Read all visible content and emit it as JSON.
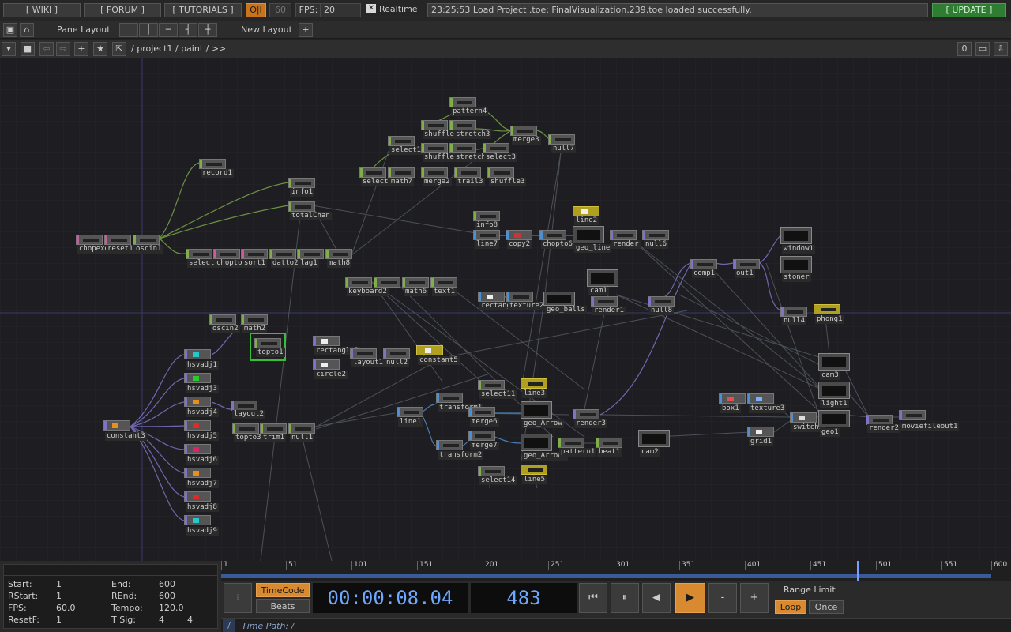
{
  "topbar": {
    "wiki": "[ WIKI ]",
    "forum": "[ FORUM ]",
    "tutorials": "[ TUTORIALS ]",
    "oi": "O|I",
    "fps_box": "60",
    "fps_label": "FPS:",
    "fps_value": "20",
    "realtime_check": "✕",
    "realtime_label": "Realtime",
    "status": "23:25:53 Load Project .toe: FinalVisualization.239.toe loaded successfully.",
    "update": "[ UPDATE ]"
  },
  "row2": {
    "pane_layout": "Pane Layout",
    "new_layout": "New Layout",
    "plus": "+"
  },
  "row3": {
    "path": "/ project1 / paint / >>",
    "counter": "0"
  },
  "nodes": [
    {
      "label": "record1"
    },
    {
      "label": "info1"
    },
    {
      "label": "totalChan"
    },
    {
      "label": "chopexec"
    },
    {
      "label": "reset1"
    },
    {
      "label": "oscin1"
    },
    {
      "label": "select5"
    },
    {
      "label": "chopto2"
    },
    {
      "label": "sort1"
    },
    {
      "label": "datto2"
    },
    {
      "label": "lag1"
    },
    {
      "label": "math8"
    },
    {
      "label": "pattern4"
    },
    {
      "label": "shuffle4"
    },
    {
      "label": "stretch3"
    },
    {
      "label": "merge3"
    },
    {
      "label": "select1"
    },
    {
      "label": "shuffle1"
    },
    {
      "label": "stretch4"
    },
    {
      "label": "select3"
    },
    {
      "label": "null7"
    },
    {
      "label": "select2"
    },
    {
      "label": "math7"
    },
    {
      "label": "merge2"
    },
    {
      "label": "trail3"
    },
    {
      "label": "shuffle3"
    },
    {
      "label": "info8"
    },
    {
      "label": "line7"
    },
    {
      "label": "chopto6"
    },
    {
      "label": "copy2"
    },
    {
      "label": "line2"
    },
    {
      "label": "geo_line"
    },
    {
      "label": "render"
    },
    {
      "label": "null6"
    },
    {
      "label": "window1"
    },
    {
      "label": "stoner"
    },
    {
      "label": "comp1"
    },
    {
      "label": "out1"
    },
    {
      "label": "null4"
    },
    {
      "label": "phong1"
    },
    {
      "label": "keyboard2"
    },
    {
      "label": "math6"
    },
    {
      "label": "text1"
    },
    {
      "label": "cam1"
    },
    {
      "label": "rectangle1"
    },
    {
      "label": "texture2"
    },
    {
      "label": "geo_balls"
    },
    {
      "label": "render1"
    },
    {
      "label": "null8"
    },
    {
      "label": "oscin2"
    },
    {
      "label": "math2"
    },
    {
      "label": "topto1"
    },
    {
      "label": "rectangle2"
    },
    {
      "label": "circle2"
    },
    {
      "label": "layout1"
    },
    {
      "label": "null2"
    },
    {
      "label": "constant5"
    },
    {
      "label": "hsvadj1"
    },
    {
      "label": "hsvadj3"
    },
    {
      "label": "hsvadj4"
    },
    {
      "label": "layout2"
    },
    {
      "label": "hsvadj5"
    },
    {
      "label": "hsvadj6"
    },
    {
      "label": "hsvadj7"
    },
    {
      "label": "hsvadj8"
    },
    {
      "label": "hsvadj9"
    },
    {
      "label": "constant3"
    },
    {
      "label": "topto3"
    },
    {
      "label": "trim1"
    },
    {
      "label": "null1"
    },
    {
      "label": "select11"
    },
    {
      "label": "line3"
    },
    {
      "label": "transform1"
    },
    {
      "label": "merge6"
    },
    {
      "label": "geo_Arrow"
    },
    {
      "label": "line1"
    },
    {
      "label": "transform2"
    },
    {
      "label": "merge7"
    },
    {
      "label": "geo_Arrow2"
    },
    {
      "label": "pattern1"
    },
    {
      "label": "beat1"
    },
    {
      "label": "render3"
    },
    {
      "label": "cam2"
    },
    {
      "label": "select14"
    },
    {
      "label": "line5"
    },
    {
      "label": "box1"
    },
    {
      "label": "texture3"
    },
    {
      "label": "grid1"
    },
    {
      "label": "switch1"
    },
    {
      "label": "geo1"
    },
    {
      "label": "cam3"
    },
    {
      "label": "light1"
    },
    {
      "label": "render2"
    },
    {
      "label": "moviefileout1"
    }
  ],
  "timeline": {
    "ticks": [
      "1",
      "51",
      "101",
      "151",
      "201",
      "251",
      "301",
      "351",
      "401",
      "451",
      "501",
      "551",
      "600"
    ],
    "start_label": "Start:",
    "start": "1",
    "rstart_label": "RStart:",
    "rstart": "1",
    "fps_label": "FPS:",
    "fps": "60.0",
    "resetf_label": "ResetF:",
    "resetf": "1",
    "end_label": "End:",
    "end": "600",
    "rend_label": "REnd:",
    "rend": "600",
    "tempo_label": "Tempo:",
    "tempo": "120.0",
    "tsig_label": "T Sig:",
    "tsig_a": "4",
    "tsig_b": "4",
    "timecode": "TimeCode",
    "beats": "Beats",
    "time": "00:00:08.04",
    "frame": "483",
    "minus": "-",
    "plus": "+",
    "range_limit": "Range Limit",
    "loop": "Loop",
    "once": "Once",
    "time_path": "Time Path: /",
    "slash": "/"
  },
  "colors": {
    "accent_orange": "#d88a30",
    "update_green": "#2f7d32",
    "selected_green": "#35c035",
    "time_blue": "#6fa8ff"
  }
}
